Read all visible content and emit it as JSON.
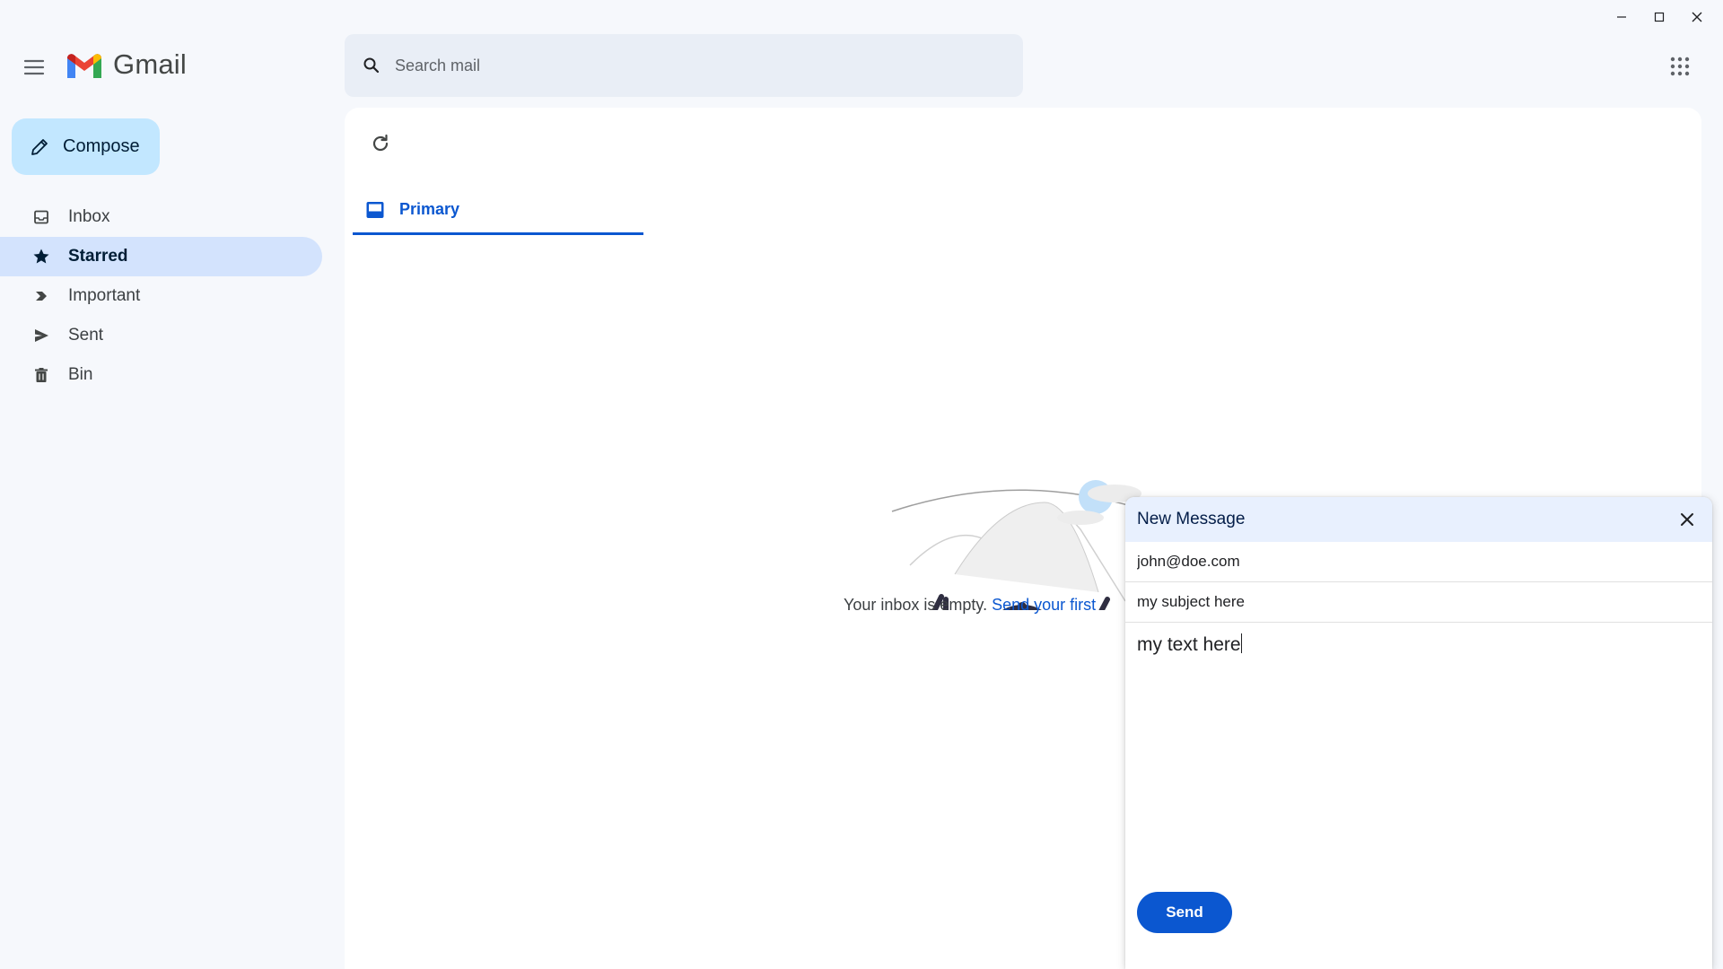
{
  "app": {
    "name": "Gmail"
  },
  "window_controls": {
    "minimize_icon": "minimize-icon",
    "maximize_icon": "maximize-icon",
    "close_icon": "close-icon"
  },
  "header": {
    "menu_icon": "hamburger-menu-icon",
    "logo_text": "Gmail",
    "search": {
      "placeholder": "Search mail",
      "value": ""
    },
    "apps_icon": "apps-grid-icon"
  },
  "compose_button": {
    "label": "Compose",
    "icon": "pencil-icon"
  },
  "sidebar": {
    "items": [
      {
        "label": "Inbox",
        "icon": "inbox-icon",
        "active": false
      },
      {
        "label": "Starred",
        "icon": "star-icon",
        "active": true
      },
      {
        "label": "Important",
        "icon": "important-icon",
        "active": false
      },
      {
        "label": "Sent",
        "icon": "send-icon",
        "active": false
      },
      {
        "label": "Bin",
        "icon": "trash-icon",
        "active": false
      }
    ]
  },
  "main": {
    "refresh_icon": "refresh-icon",
    "tabs": [
      {
        "label": "Primary",
        "icon": "inbox-tab-icon",
        "selected": true
      }
    ],
    "empty_state": {
      "art_text": "404",
      "text": "Your inbox is empty. ",
      "link": "Send your first"
    }
  },
  "new_message": {
    "title": "New Message",
    "to": "john@doe.com",
    "subject": "my subject here",
    "body": "my text here",
    "send_label": "Send"
  },
  "colors": {
    "background": "#f6f8fc",
    "accent": "#0b57d0",
    "compose_bg": "#c2e7ff",
    "active_nav_bg": "#d3e3fd",
    "search_bg": "#e9eef6"
  }
}
